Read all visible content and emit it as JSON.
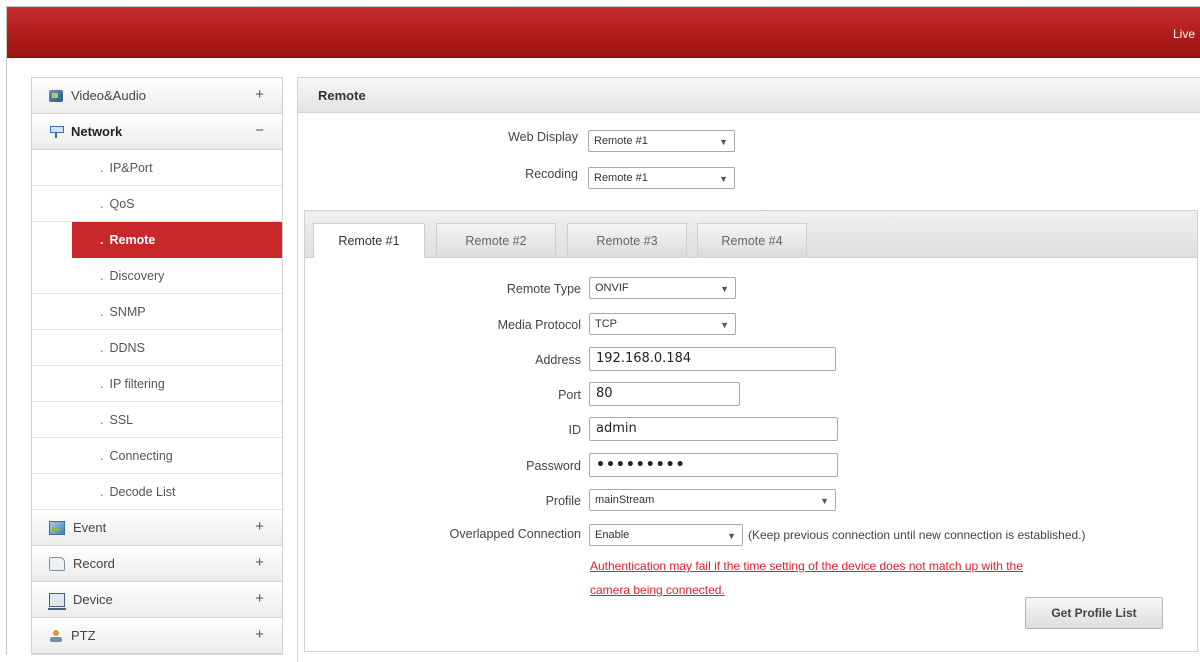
{
  "topbar": {
    "live_label": "Live"
  },
  "sidebar": {
    "video_audio": {
      "label": "Video&Audio",
      "toggle": "+"
    },
    "network": {
      "label": "Network",
      "toggle": "−"
    },
    "network_items": [
      "IP&Port",
      "QoS",
      "Remote",
      "Discovery",
      "SNMP",
      "DDNS",
      "IP filtering",
      "SSL",
      "Connecting",
      "Decode List"
    ],
    "active_item": "Remote",
    "event": {
      "label": "Event",
      "toggle": "+"
    },
    "record": {
      "label": "Record",
      "toggle": "+"
    },
    "device": {
      "label": "Device",
      "toggle": "+"
    },
    "ptz": {
      "label": "PTZ",
      "toggle": "+"
    }
  },
  "panel": {
    "title": "Remote",
    "web_display": {
      "label": "Web Display",
      "value": "Remote #1"
    },
    "recoding": {
      "label": "Recoding",
      "value": "Remote #1"
    }
  },
  "tabs": [
    "Remote #1",
    "Remote #2",
    "Remote #3",
    "Remote #4"
  ],
  "active_tab": "Remote #1",
  "form": {
    "remote_type": {
      "label": "Remote Type",
      "value": "ONVIF"
    },
    "media_protocol": {
      "label": "Media Protocol",
      "value": "TCP"
    },
    "address": {
      "label": "Address",
      "value": "192.168.0.184"
    },
    "port": {
      "label": "Port",
      "value": "80"
    },
    "id": {
      "label": "ID",
      "value": "admin"
    },
    "password": {
      "label": "Password",
      "value": "•••••••••"
    },
    "profile": {
      "label": "Profile",
      "value": "mainStream"
    },
    "overlapped": {
      "label": "Overlapped Connection",
      "value": "Enable",
      "note": "(Keep previous connection until new connection is established.)"
    },
    "warning_line1": "Authentication may fail if the time setting of the device does not match up with the",
    "warning_line2": "camera being connected.",
    "get_profile_button": "Get Profile List"
  },
  "colors": {
    "topbar": "#b01d1d",
    "active_menu": "#c8282a",
    "warning": "#e0202b"
  }
}
